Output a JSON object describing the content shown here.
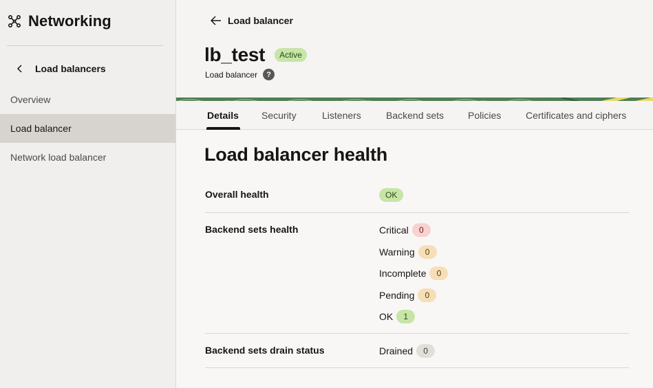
{
  "sidebar": {
    "title": "Networking",
    "back_label": "Load balancers",
    "items": [
      {
        "label": "Overview"
      },
      {
        "label": "Load balancer"
      },
      {
        "label": "Network load balancer"
      }
    ]
  },
  "header": {
    "back_label": "Load balancer",
    "title": "lb_test",
    "status": "Active",
    "subtitle": "Load balancer",
    "help_glyph": "?"
  },
  "tabs": [
    {
      "label": "Details"
    },
    {
      "label": "Security"
    },
    {
      "label": "Listeners"
    },
    {
      "label": "Backend sets"
    },
    {
      "label": "Policies"
    },
    {
      "label": "Certificates and ciphers"
    }
  ],
  "health": {
    "title": "Load balancer health",
    "overall": {
      "label": "Overall health",
      "value": "OK"
    },
    "backend_sets": {
      "label": "Backend sets health",
      "items": [
        {
          "label": "Critical",
          "count": "0"
        },
        {
          "label": "Warning",
          "count": "0"
        },
        {
          "label": "Incomplete",
          "count": "0"
        },
        {
          "label": "Pending",
          "count": "0"
        },
        {
          "label": "OK",
          "count": "1"
        }
      ]
    },
    "drain": {
      "label": "Backend sets drain status",
      "item": {
        "label": "Drained",
        "count": "0"
      }
    }
  },
  "colors": {
    "ok_green": "#c7e5a6",
    "critical_red": "#f8d2cf",
    "warning_orange": "#f6dfb8",
    "neutral_gray": "#e2dfdb"
  },
  "icons": {
    "brand": "network-nodes-icon",
    "sidebar_back": "chevron-left-icon",
    "header_back": "arrow-left-icon",
    "help": "question-circle-icon"
  }
}
